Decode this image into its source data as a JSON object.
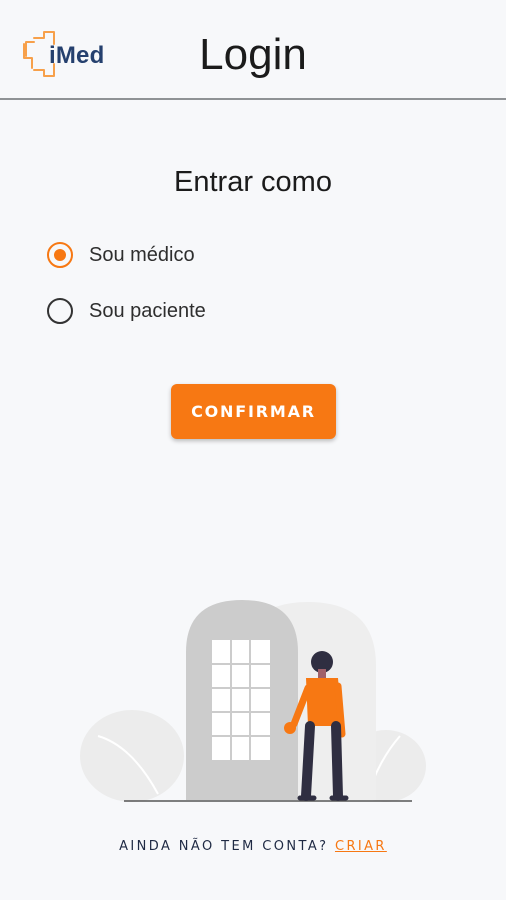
{
  "header": {
    "logo_text": "iMed",
    "title": "Login"
  },
  "login": {
    "subtitle": "Entrar como",
    "options": [
      {
        "label": "Sou médico",
        "selected": true
      },
      {
        "label": "Sou paciente",
        "selected": false
      }
    ],
    "confirm_label": "CONFIRMAR"
  },
  "footer": {
    "prompt": "AINDA NÃO TEM CONTA?",
    "link": "CRIAR"
  },
  "colors": {
    "accent": "#f77813",
    "logo_text": "#25406e",
    "background": "#f7f8fa"
  }
}
